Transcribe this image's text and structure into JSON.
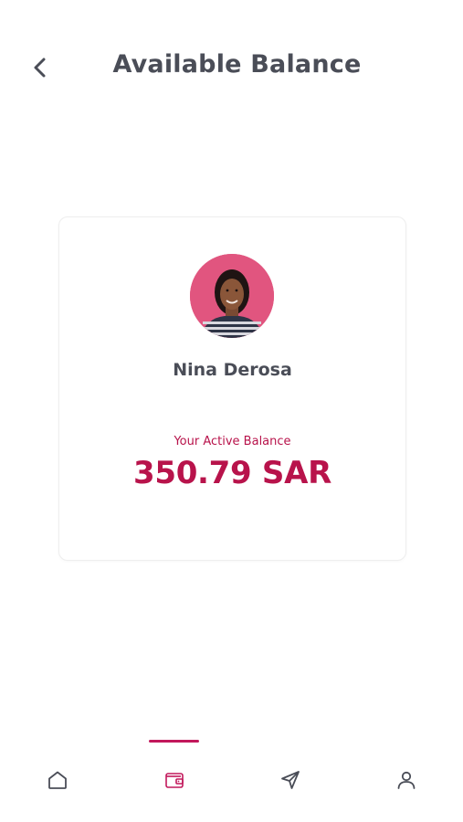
{
  "header": {
    "title": "Available Balance",
    "back_icon": "chevron-left-icon"
  },
  "profile": {
    "name": "Nina Derosa",
    "avatar_bg": "#e1557f"
  },
  "balance": {
    "label": "Your Active Balance",
    "amount": "350.79 SAR",
    "accent_color": "#b8134b"
  },
  "bottom_nav": {
    "items": [
      {
        "icon": "home-icon",
        "active": false
      },
      {
        "icon": "wallet-icon",
        "active": true
      },
      {
        "icon": "send-icon",
        "active": false
      },
      {
        "icon": "user-icon",
        "active": false
      }
    ],
    "active_color": "#c2185b",
    "inactive_color": "#4a4d57"
  }
}
